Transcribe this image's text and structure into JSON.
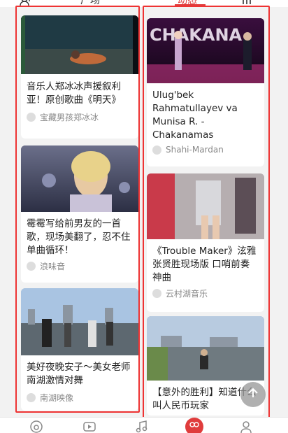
{
  "top_tabs": {
    "left_icon": "add-user-icon",
    "middle_label": "广场",
    "active_label": "动态",
    "right_icon": "menu-icon"
  },
  "left_column": [
    {
      "title": "音乐人郑冰冰声援叙利亚！原创歌曲《明天》",
      "author": "宝藏男孩郑冰冰"
    },
    {
      "title": "霉霉写给前男友的一首歌，现场美翻了，忍不住单曲循环！",
      "author": "浪味音"
    },
    {
      "title": "美好夜晚安子～美女老师南湖激情对舞",
      "author": "南湖映像"
    }
  ],
  "right_column": [
    {
      "title": "Ulug'bek Rahmatullayev va Munisa R. - Chakanamas",
      "author": "Shahi-Mardan",
      "thumb_text": "CHAKANA"
    },
    {
      "title": "《Trouble Maker》泫雅 张贤胜现场版 口哨前奏神曲",
      "author": "云村湖音乐"
    },
    {
      "title": "【意外的胜利】知道什么叫人民币玩家",
      "author": ""
    }
  ],
  "bottom_nav": [
    "netease-music-icon",
    "video-icon",
    "music-note-icon",
    "community-icon",
    "profile-icon"
  ],
  "colors": {
    "accent": "#e03c3c",
    "highlight_border": "#e33333"
  }
}
